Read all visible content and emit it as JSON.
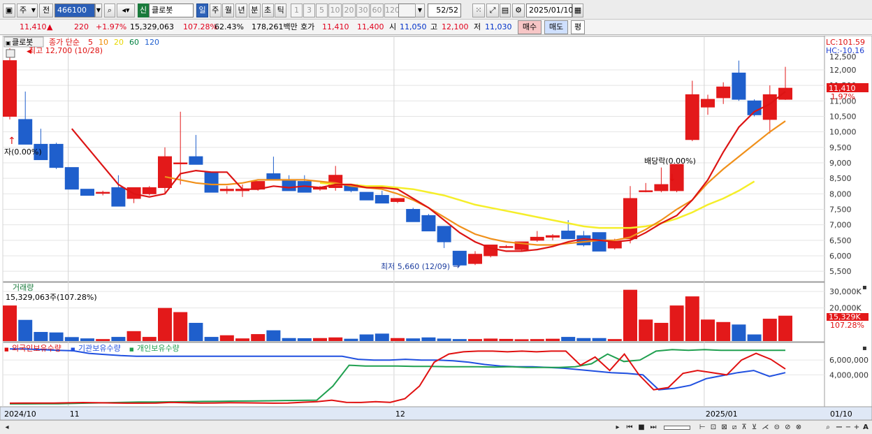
{
  "toolbar": {
    "market": "주",
    "prev": "전",
    "code": "466100",
    "new_badge": "신",
    "name": "클로봇",
    "periods": [
      "일",
      "주",
      "월",
      "년",
      "분",
      "초",
      "틱"
    ],
    "active_period": "일",
    "minutes": [
      "1",
      "3",
      "5",
      "10",
      "20",
      "30",
      "60",
      "120"
    ],
    "count": "52",
    "count_total": "/52",
    "date": "2025/01/10"
  },
  "quote": {
    "price": "11,410",
    "arrow": "▲",
    "change": "220",
    "change_pct": "+1.97%",
    "volume": "15,329,063",
    "vol_ratio": "107.28%",
    "turnover": "62.43%",
    "amount": "178,261백만",
    "ask_label": "호가",
    "ask": "11,410",
    "bid": "11,400",
    "open_label": "시",
    "open": "11,050",
    "high_label": "고",
    "high": "12,100",
    "low_label": "저",
    "low": "11,030",
    "buy": "매수",
    "sell": "매도",
    "avg": "평"
  },
  "legend": {
    "name": "클로봇",
    "ma_label": "종가 단순",
    "ma": [
      {
        "p": "5",
        "color": "#e01010"
      },
      {
        "p": "10",
        "color": "#f08a00"
      },
      {
        "p": "20",
        "color": "#e8d800"
      },
      {
        "p": "60",
        "color": "#008040"
      },
      {
        "p": "120",
        "color": "#2060d0"
      }
    ],
    "lc": "LC:101.59",
    "hc": "HC:-10.16"
  },
  "annotations": {
    "high_note": "최고 12,700 (10/28)",
    "low_note": "최저 5,660 (12/09)",
    "left_note": "자(0.00%)",
    "dividend_note": "배당락(0.00%)"
  },
  "volume_panel": {
    "title": "거래량",
    "value": "15,329,063주(107.28%)",
    "axis": [
      "30,000K",
      "20,000K"
    ],
    "current": "15,329K",
    "current_pct": "107.28%"
  },
  "holdings_panel": {
    "labels": [
      "외국인보유수량",
      "기관보유수량",
      "개인보유수량"
    ],
    "colors": [
      "#e01010",
      "#2050e0",
      "#20a050"
    ],
    "axis": [
      "6,000,000",
      "4,000,000"
    ]
  },
  "xaxis": {
    "labels": [
      {
        "text": "2024/10",
        "i": 0
      },
      {
        "text": "11",
        "i": 4
      },
      {
        "text": "12",
        "i": 25
      },
      {
        "text": "2025/01",
        "i": 45
      }
    ],
    "right_label": "01/10"
  },
  "price_axis": [
    "12,000",
    "11,500",
    "11,000",
    "10,500",
    "10,000",
    "9,500",
    "9,000",
    "8,500",
    "8,000",
    "7,500",
    "7,000",
    "6,500",
    "6,000",
    "5,500"
  ],
  "price_axis_top": "12,500",
  "current_price": "11,410",
  "current_pct": "1.97%",
  "chart_data": {
    "type": "candlestick",
    "ohlc": [
      [
        10500,
        12700,
        10400,
        12300
      ],
      [
        10400,
        11300,
        9700,
        9600
      ],
      [
        9600,
        10100,
        9250,
        9100
      ],
      [
        9600,
        9650,
        8800,
        8850
      ],
      [
        8850,
        8850,
        8150,
        8150
      ],
      [
        8150,
        8150,
        7950,
        7950
      ],
      [
        8050,
        8100,
        7950,
        8050
      ],
      [
        8200,
        8600,
        7600,
        7600
      ],
      [
        7850,
        8200,
        7700,
        8200
      ],
      [
        8000,
        8250,
        7950,
        8200
      ],
      [
        8200,
        9500,
        8000,
        9200
      ],
      [
        9000,
        10650,
        8300,
        9000
      ],
      [
        9200,
        9900,
        9000,
        8950
      ],
      [
        8700,
        8700,
        8050,
        8050
      ],
      [
        8100,
        8250,
        8000,
        8150
      ],
      [
        8100,
        8300,
        7900,
        8150
      ],
      [
        8150,
        8400,
        8100,
        8400
      ],
      [
        8650,
        9200,
        8500,
        8450
      ],
      [
        8450,
        8600,
        8100,
        8100
      ],
      [
        8400,
        8600,
        8050,
        8050
      ],
      [
        8150,
        8250,
        8100,
        8200
      ],
      [
        8200,
        8900,
        8100,
        8600
      ],
      [
        8300,
        8300,
        8050,
        8100
      ],
      [
        8050,
        8050,
        7800,
        7800
      ],
      [
        7950,
        8100,
        7700,
        7700
      ],
      [
        7750,
        7800,
        7700,
        7850
      ],
      [
        7500,
        7550,
        7100,
        7100
      ],
      [
        7300,
        7350,
        6800,
        6800
      ],
      [
        6950,
        6950,
        6250,
        6450
      ],
      [
        6150,
        6150,
        5660,
        5700
      ],
      [
        5750,
        6150,
        5700,
        6050
      ],
      [
        6000,
        6350,
        5950,
        6350
      ],
      [
        6300,
        6350,
        6250,
        6300
      ],
      [
        6200,
        6450,
        6150,
        6450
      ],
      [
        6500,
        6800,
        6450,
        6600
      ],
      [
        6600,
        6700,
        6500,
        6650
      ],
      [
        6800,
        7150,
        6550,
        6550
      ],
      [
        6650,
        6800,
        6300,
        6350
      ],
      [
        6750,
        6750,
        6150,
        6150
      ],
      [
        6250,
        6550,
        6200,
        6450
      ],
      [
        6550,
        8250,
        6400,
        7850
      ],
      [
        8100,
        8350,
        8050,
        8100
      ],
      [
        8100,
        8850,
        8050,
        8300
      ],
      [
        8100,
        8950,
        8050,
        8950
      ],
      [
        9750,
        11650,
        9700,
        11200
      ],
      [
        10800,
        11200,
        10550,
        11050
      ],
      [
        11100,
        11600,
        10900,
        11450
      ],
      [
        11900,
        12300,
        11000,
        11050
      ],
      [
        11000,
        11050,
        10500,
        10550
      ],
      [
        10400,
        11500,
        9950,
        11200
      ],
      [
        11050,
        12100,
        11030,
        11410
      ]
    ],
    "volume_k": [
      21500,
      12800,
      5500,
      5200,
      2400,
      1600,
      1200,
      2500,
      6000,
      2500,
      20000,
      17500,
      11000,
      2500,
      3500,
      1600,
      4200,
      6500,
      1800,
      1700,
      1800,
      2200,
      1400,
      4000,
      4500,
      1800,
      1600,
      2200,
      1500,
      1200,
      1200,
      1500,
      1300,
      1100,
      1200,
      1400,
      2500,
      1800,
      1800,
      1200,
      31000,
      13000,
      11000,
      21500,
      27000,
      13000,
      11500,
      10000,
      4000,
      13500,
      15329
    ],
    "ma5": [
      null,
      null,
      null,
      null,
      10100,
      9500,
      8900,
      8300,
      8000,
      7900,
      8000,
      8650,
      8750,
      8700,
      8700,
      8150,
      8150,
      8250,
      8200,
      8250,
      8200,
      8300,
      8300,
      8200,
      8200,
      8150,
      7850,
      7550,
      7150,
      6750,
      6450,
      6250,
      6150,
      6150,
      6200,
      6300,
      6450,
      6550,
      6500,
      6450,
      6500,
      6750,
      7050,
      7300,
      7800,
      8450,
      9350,
      10150,
      10650,
      10900,
      11300
    ],
    "ma10": [
      null,
      null,
      null,
      null,
      null,
      null,
      null,
      null,
      null,
      null,
      8550,
      8450,
      8350,
      8300,
      8300,
      8350,
      8450,
      8450,
      8450,
      8450,
      8400,
      8350,
      8250,
      8200,
      8150,
      8000,
      7800,
      7550,
      7250,
      6950,
      6700,
      6550,
      6450,
      6400,
      6350,
      6350,
      6400,
      6450,
      6500,
      6500,
      6600,
      6850,
      7150,
      7500,
      7800,
      8350,
      8800,
      9200,
      9600,
      10000,
      10350
    ],
    "ma20": [
      null,
      null,
      null,
      null,
      null,
      null,
      null,
      null,
      null,
      null,
      null,
      null,
      null,
      null,
      null,
      null,
      null,
      null,
      null,
      null,
      8350,
      8300,
      8300,
      8250,
      8250,
      8200,
      8150,
      8050,
      7950,
      7800,
      7650,
      7550,
      7450,
      7350,
      7250,
      7150,
      7050,
      6950,
      6900,
      6900,
      6900,
      6950,
      7050,
      7200,
      7400,
      7650,
      7850,
      8100,
      8400
    ],
    "foreign": [
      200,
      210,
      210,
      215,
      240,
      280,
      260,
      230,
      200,
      200,
      210,
      300,
      260,
      220,
      230,
      250,
      240,
      230,
      200,
      220,
      320,
      400,
      600,
      300,
      290,
      400,
      310,
      800,
      2500,
      5700,
      6800,
      7100,
      7200,
      7200,
      7100,
      7200,
      7100,
      7200,
      7200,
      5300,
      6400,
      4600,
      6800,
      4000,
      2000,
      2300,
      4200,
      4600,
      4300,
      4000,
      6000,
      6900,
      6100,
      4800
    ],
    "institution": [
      7500,
      7480,
      7400,
      7300,
      7250,
      6900,
      6750,
      6600,
      6500,
      6500,
      6500,
      6500,
      6500,
      6500,
      6500,
      6500,
      6500,
      6500,
      6500,
      6500,
      6500,
      6500,
      6100,
      6000,
      6000,
      6100,
      6000,
      6000,
      5900,
      5700,
      5400,
      5200,
      5100,
      5100,
      5000,
      4900,
      4700,
      4500,
      4300,
      4200,
      4000,
      2000,
      2200,
      2600,
      3500,
      3900,
      4300,
      4600,
      3800,
      4300
    ],
    "individual": [
      100,
      100,
      110,
      120,
      160,
      220,
      260,
      310,
      350,
      350,
      380,
      400,
      430,
      450,
      480,
      500,
      520,
      550,
      570,
      600,
      2500,
      5300,
      5200,
      5200,
      5200,
      5150,
      5150,
      5100,
      5100,
      5100,
      5050,
      5100,
      5000,
      5000,
      5000,
      5100,
      5500,
      6800,
      5800,
      6000,
      7200,
      7400,
      7300,
      7400,
      7300,
      7300,
      7300,
      7300,
      7300
    ]
  }
}
